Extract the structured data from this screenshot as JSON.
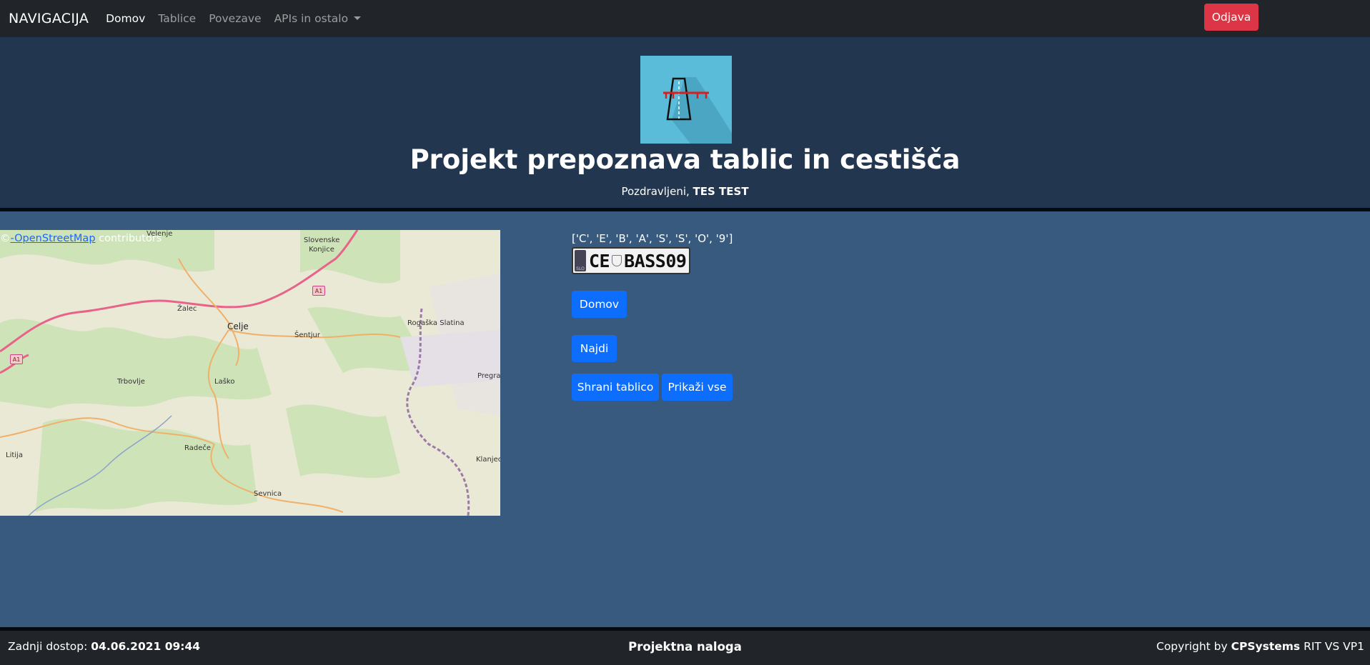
{
  "navbar": {
    "brand": "NAVIGACIJA",
    "items": [
      {
        "label": "Domov",
        "active": true
      },
      {
        "label": "Tablice",
        "active": false
      },
      {
        "label": "Povezave",
        "active": false
      },
      {
        "label": "APIs in ostalo",
        "active": false,
        "dropdown": true
      }
    ],
    "logout_label": "Odjava",
    "logout_color": "#dc3545"
  },
  "header": {
    "logo_icon": "road-icon",
    "title": "Projekt prepoznava tablic in cestišča",
    "greeting_prefix": "Pozdravljeni, ",
    "user_name": "TES TEST"
  },
  "map": {
    "attribution_link": "-OpenStreetMap",
    "attribution_suffix": " contributors",
    "attribution_symbol": "©",
    "places": {
      "velenje": "Velenje",
      "slovenske_konjice": "Slovenske Konjice",
      "zalec": "Žalec",
      "celje": "Celje",
      "sentjur": "Šentjur",
      "rogaska_slatina": "Rogaška Slatina",
      "trbovlje": "Trbovlje",
      "lasko": "Laško",
      "pregrada": "Pregra",
      "litija": "Litija",
      "radece": "Radeče",
      "klanjec": "Klanjec",
      "sevnica": "Sevnica"
    },
    "road_shields": [
      "A1",
      "A1"
    ]
  },
  "recognition": {
    "characters": "['C', 'E', 'B', 'A', 'S', 'S', 'O', '9']",
    "plate_left": "CE",
    "plate_right": "BASS09",
    "plate_country": "SLO"
  },
  "buttons": {
    "home": "Domov",
    "find": "Najdi",
    "save_plate": "Shrani tablico",
    "show_all": "Prikaži vse",
    "color": "#0d6efd"
  },
  "footer": {
    "last_access_label": "Zadnji dostop: ",
    "last_access_value": "04.06.2021 09:44",
    "center": "Projektna naloga",
    "copyright_prefix": "Copyright by ",
    "company": "CPSystems",
    "copyright_suffix": " RIT VS VP1"
  }
}
